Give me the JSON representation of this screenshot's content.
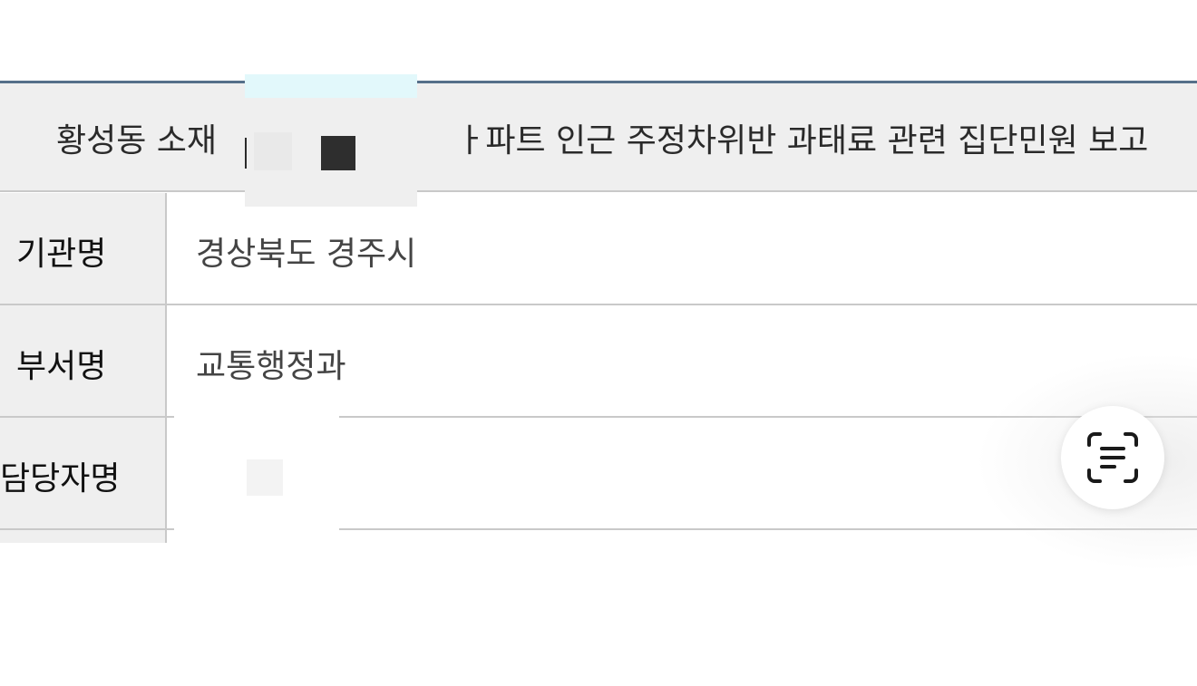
{
  "title_row": {
    "text": "황성동 소재                       ㅏ파트 인근 주정차위반 과태료 관련 집단민원 보고"
  },
  "rows": [
    {
      "label": "기관명",
      "value": "경상북도 경주시"
    },
    {
      "label": "부서명",
      "value": "교통행정과"
    },
    {
      "label": "담당자명",
      "value": ""
    }
  ],
  "icons": {
    "scan_text": "scan-text-icon"
  },
  "colors": {
    "top_rule": "#55708a",
    "label_bg": "#efefef",
    "border": "#c9c9c9"
  }
}
